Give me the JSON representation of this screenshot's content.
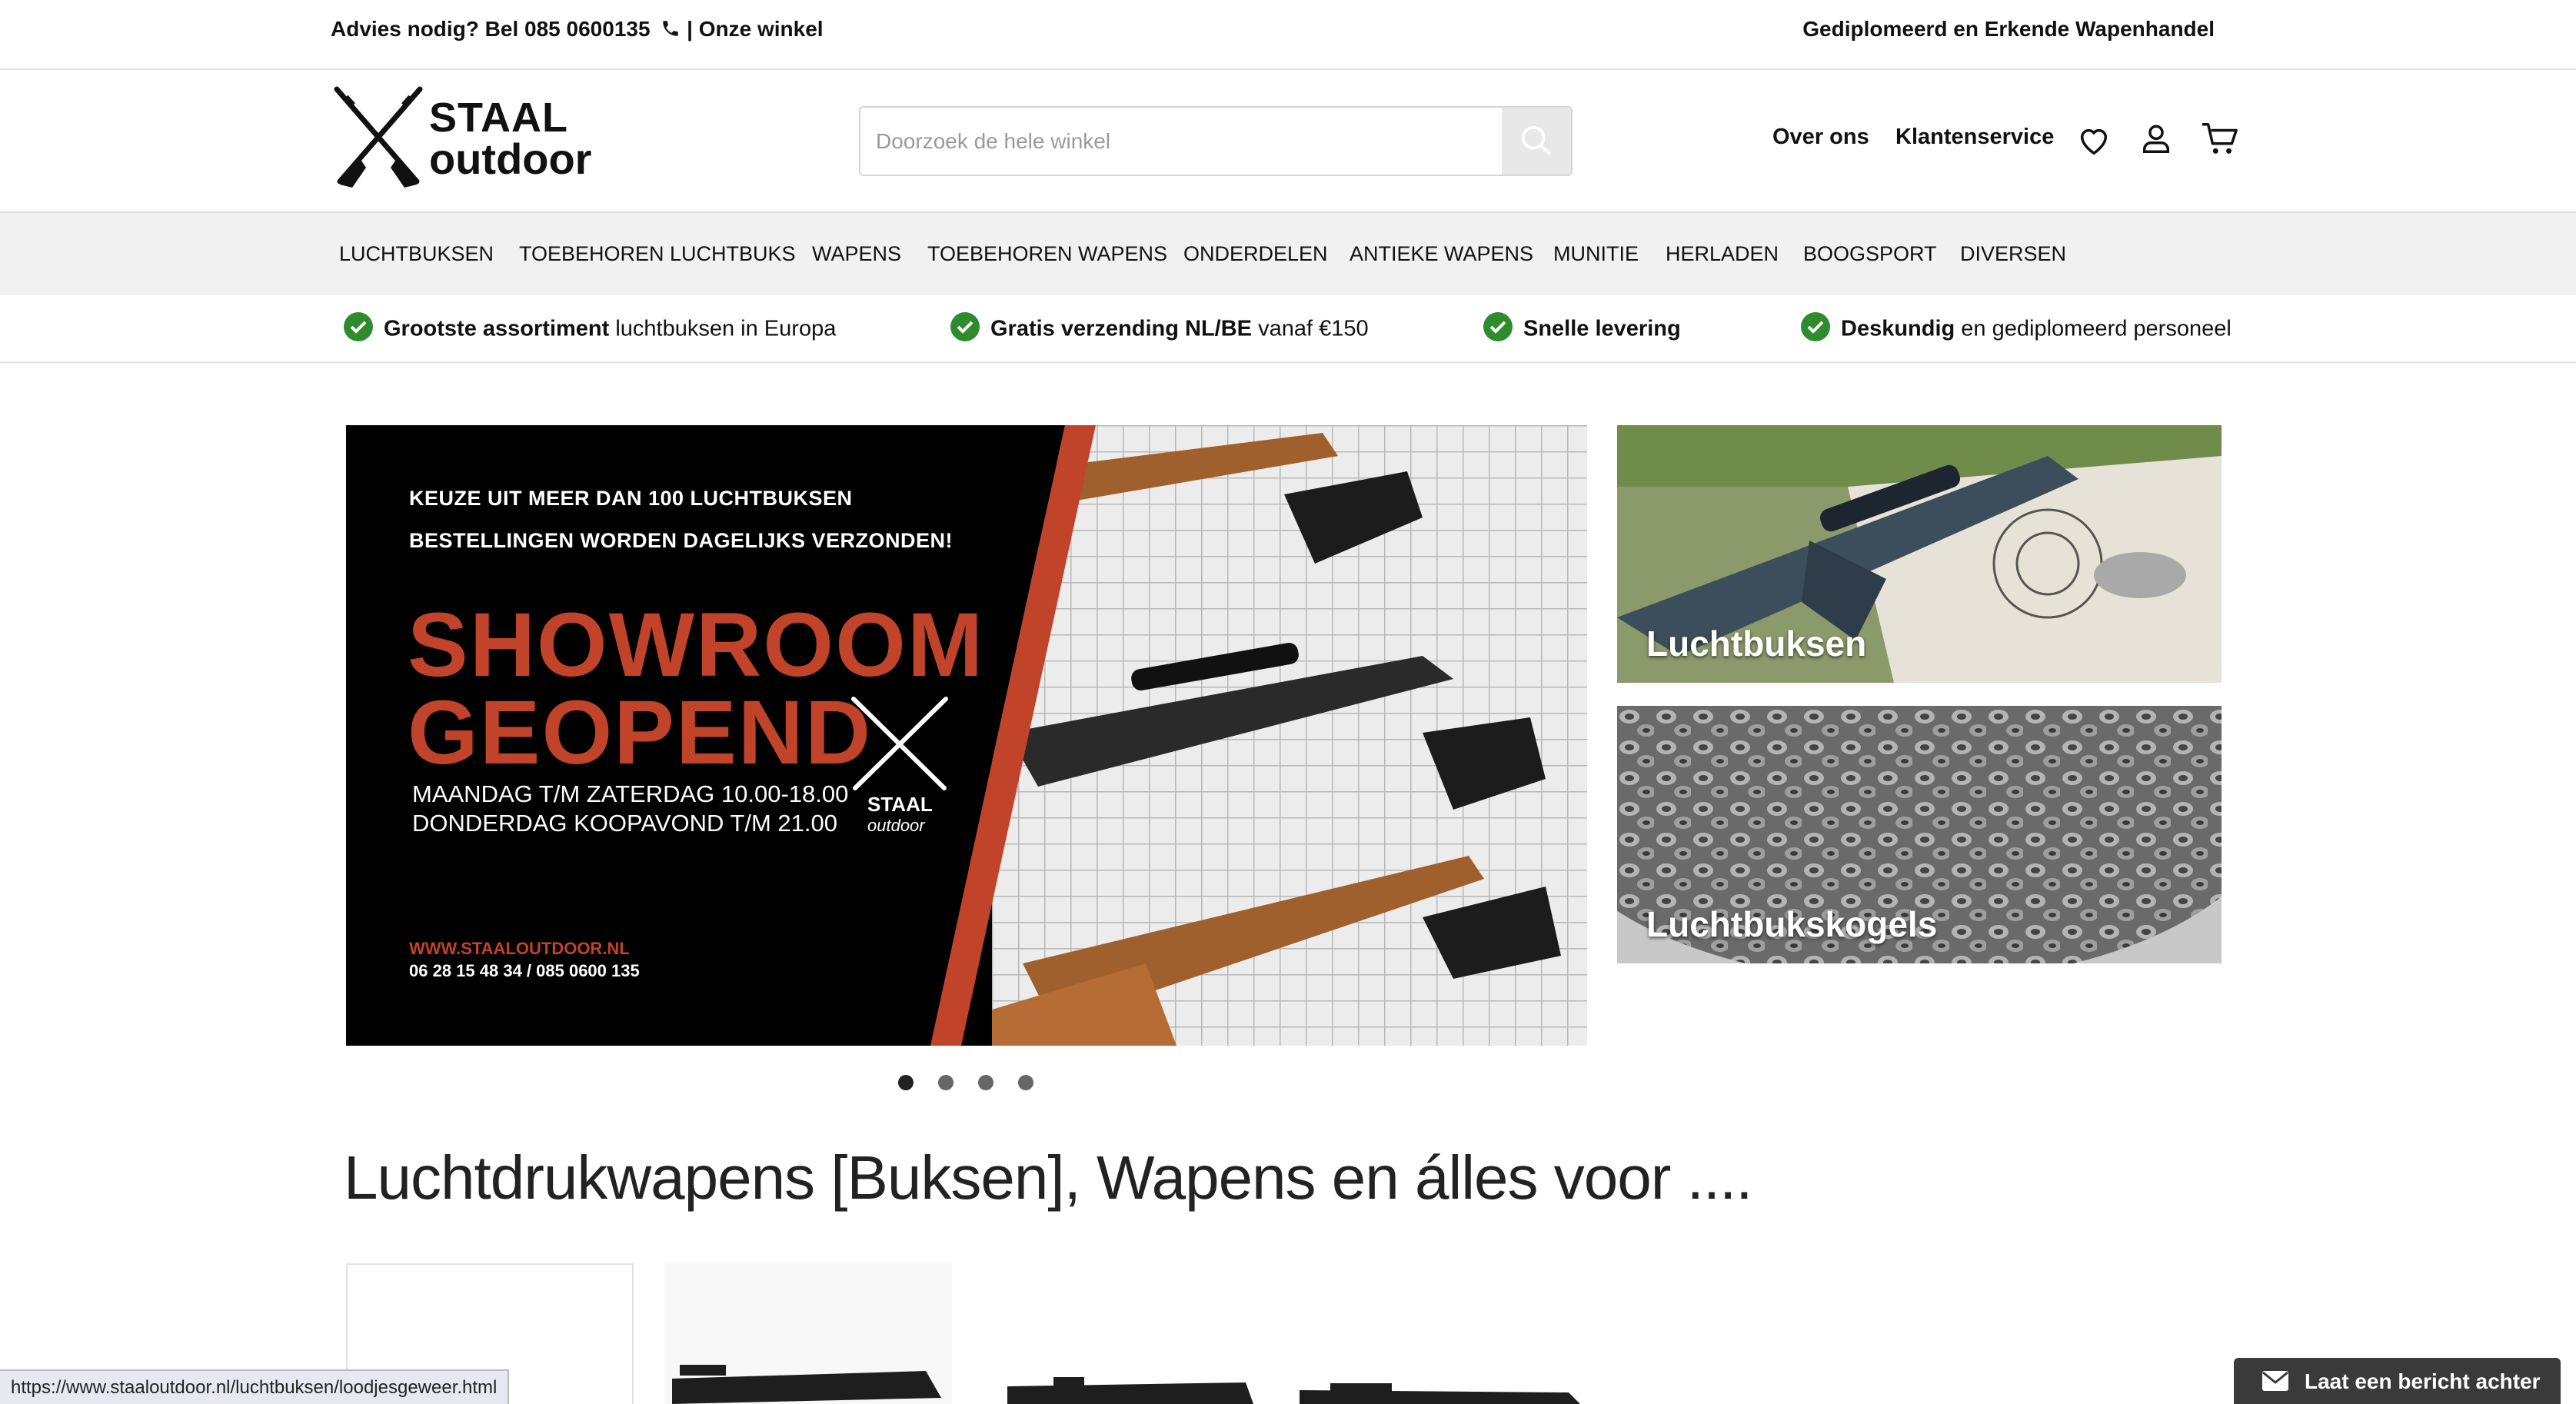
{
  "topbar": {
    "advice_prefix": "Advies nodig? Bel 085 0600135",
    "separator": "|",
    "store_link": "Onze winkel",
    "right_text": "Gediplomeerd en Erkende Wapenhandel"
  },
  "logo": {
    "line1": "STAAL",
    "line2": "outdoor"
  },
  "search": {
    "placeholder": "Doorzoek de hele winkel"
  },
  "header_links": {
    "about": "Over ons",
    "service": "Klantenservice"
  },
  "header_icons": [
    "heart-icon",
    "user-icon",
    "cart-icon"
  ],
  "nav": {
    "items": [
      "LUCHTBUKSEN",
      "TOEBEHOREN LUCHTBUKS",
      "WAPENS",
      "TOEBEHOREN WAPENS",
      "ONDERDELEN",
      "ANTIEKE WAPENS",
      "MUNITIE",
      "HERLADEN",
      "BOOGSPORT",
      "DIVERSEN"
    ]
  },
  "usps": [
    {
      "bold": "Grootste assortiment",
      "rest": " luchtbuksen in Europa"
    },
    {
      "bold": "Gratis verzending NL/BE",
      "rest": " vanaf €150"
    },
    {
      "bold": "Snelle levering",
      "rest": ""
    },
    {
      "bold": "Deskundig",
      "rest": " en gediplomeerd personeel"
    }
  ],
  "banner": {
    "line1": "KEUZE UIT MEER DAN 100 LUCHTBUKSEN",
    "line2": "BESTELLINGEN WORDEN DAGELIJKS VERZONDEN!",
    "headline1": "SHOWROOM",
    "headline2": "GEOPEND",
    "hours1": "MAANDAG T/M ZATERDAG 10.00-18.00",
    "hours2": "DONDERDAG KOOPAVOND T/M 21.00",
    "logo_line1": "STAAL",
    "logo_line2": "outdoor",
    "url": "WWW.STAALOUTDOOR.NL",
    "phones": "06 28 15 48 34  /  085 0600 135",
    "slide_count": 4,
    "active_slide": 1
  },
  "tiles": [
    {
      "label": "Luchtbuksen"
    },
    {
      "label": "Luchtbukskogels"
    }
  ],
  "section_title": "Luchtdrukwapens [Buksen], Wapens en álles voor ....",
  "status_url": "https://www.staaloutdoor.nl/luchtbuksen/loodjesgeweer.html",
  "chat": {
    "label": "Laat een bericht achter"
  },
  "colors": {
    "accent_red": "#c0432a",
    "check_green": "#2e8b2e",
    "nav_bg": "#f1f1f1"
  }
}
